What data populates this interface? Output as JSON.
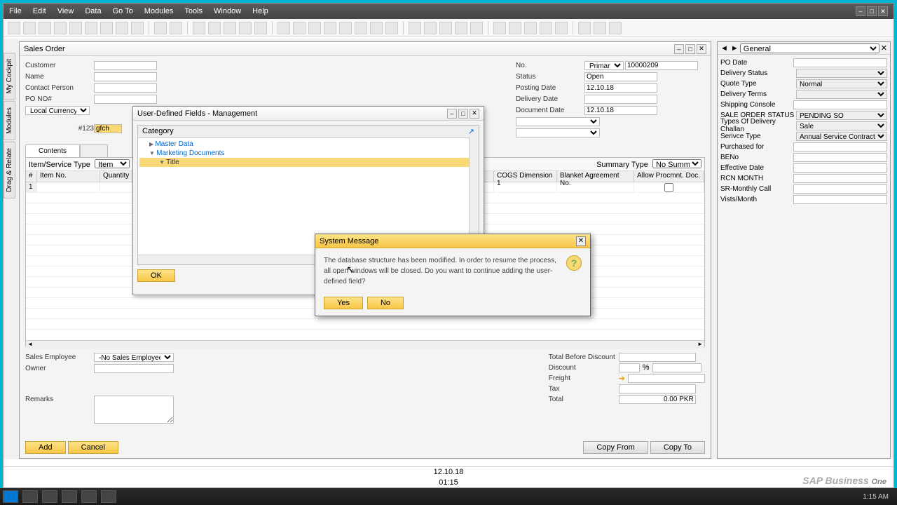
{
  "menu": {
    "file": "File",
    "edit": "Edit",
    "view": "View",
    "data": "Data",
    "goto": "Go To",
    "modules": "Modules",
    "tools": "Tools",
    "window": "Window",
    "help": "Help"
  },
  "sidebar": {
    "cockpit": "My Cockpit",
    "modules": "Modules",
    "drag": "Drag & Relate"
  },
  "salesOrder": {
    "title": "Sales Order",
    "labels": {
      "customer": "Customer",
      "name": "Name",
      "contact": "Contact Person",
      "pono": "PO NO#",
      "currency": "Local Currency",
      "no": "No.",
      "primary": "Primary",
      "docnum": "10000209",
      "status": "Status",
      "statusVal": "Open",
      "postingDate": "Posting Date",
      "postingDateVal": "12.10.18",
      "deliveryDate": "Delivery Date",
      "documentDate": "Document Date",
      "documentDateVal": "12.10.18",
      "t123": "#123",
      "gfch": "gfch"
    },
    "tabs": {
      "contents": "Contents"
    },
    "grid": {
      "itemService": "Item/Service Type",
      "item": "Item",
      "summaryType": "Summary Type",
      "noSummary": "No Summary",
      "colNum": "#",
      "colItemNo": "Item No.",
      "colQty": "Quantity",
      "colCogs": "COGS Dimension 1",
      "colBlanket": "Blanket Agreement No.",
      "colAllow": "Allow Procmnt. Doc.",
      "row1": "1"
    },
    "bottom": {
      "salesEmp": "Sales Employee",
      "salesEmpVal": "-No Sales Employee-",
      "owner": "Owner",
      "remarks": "Remarks",
      "totalBefore": "Total Before Discount",
      "discount": "Discount",
      "pct": "%",
      "freight": "Freight",
      "tax": "Tax",
      "total": "Total",
      "totalVal": "0.00 PKR"
    },
    "buttons": {
      "add": "Add",
      "cancel": "Cancel",
      "copyFrom": "Copy From",
      "copyTo": "Copy To"
    }
  },
  "udfPanel": {
    "general": "General",
    "fields": {
      "poDate": "PO Date",
      "deliveryStatus": "Delivery Status",
      "quoteType": "Quote Type",
      "quoteTypeVal": "Normal",
      "deliveryTerms": "Delivery Terms",
      "shippingConsole": "Shipping Console",
      "saleOrderStatus": "SALE ORDER STATUS",
      "saleOrderStatusVal": "PENDING SO",
      "typesDelivery": "Types Of Delivery Challan",
      "typesDeliveryVal": "Sale",
      "serviceType": "Serivce Type",
      "serviceTypeVal": "Annual Service Contract",
      "purchasedFor": "Purchased for",
      "beno": "BENo",
      "effectiveDate": "Effective Date",
      "rcnMonth": "RCN MONTH",
      "srMonthly": "SR-Monthly Call",
      "vistsMonth": "Vists/Month"
    }
  },
  "udfMgmt": {
    "title": "User-Defined Fields - Management",
    "category": "Category",
    "tree": {
      "masterData": "Master Data",
      "marketingDocs": "Marketing Documents",
      "titleItem": "Title"
    },
    "ok": "OK"
  },
  "sysMsg": {
    "title": "System Message",
    "text": "The database structure has been modified. In order to resume the process, all open windows will be closed. Do you want to continue adding the user-defined field?",
    "yes": "Yes",
    "no": "No"
  },
  "status": {
    "date": "12.10.18",
    "time": "01:15",
    "sap": "SAP Business One"
  },
  "taskbar": {
    "clock": "1:15 AM"
  }
}
